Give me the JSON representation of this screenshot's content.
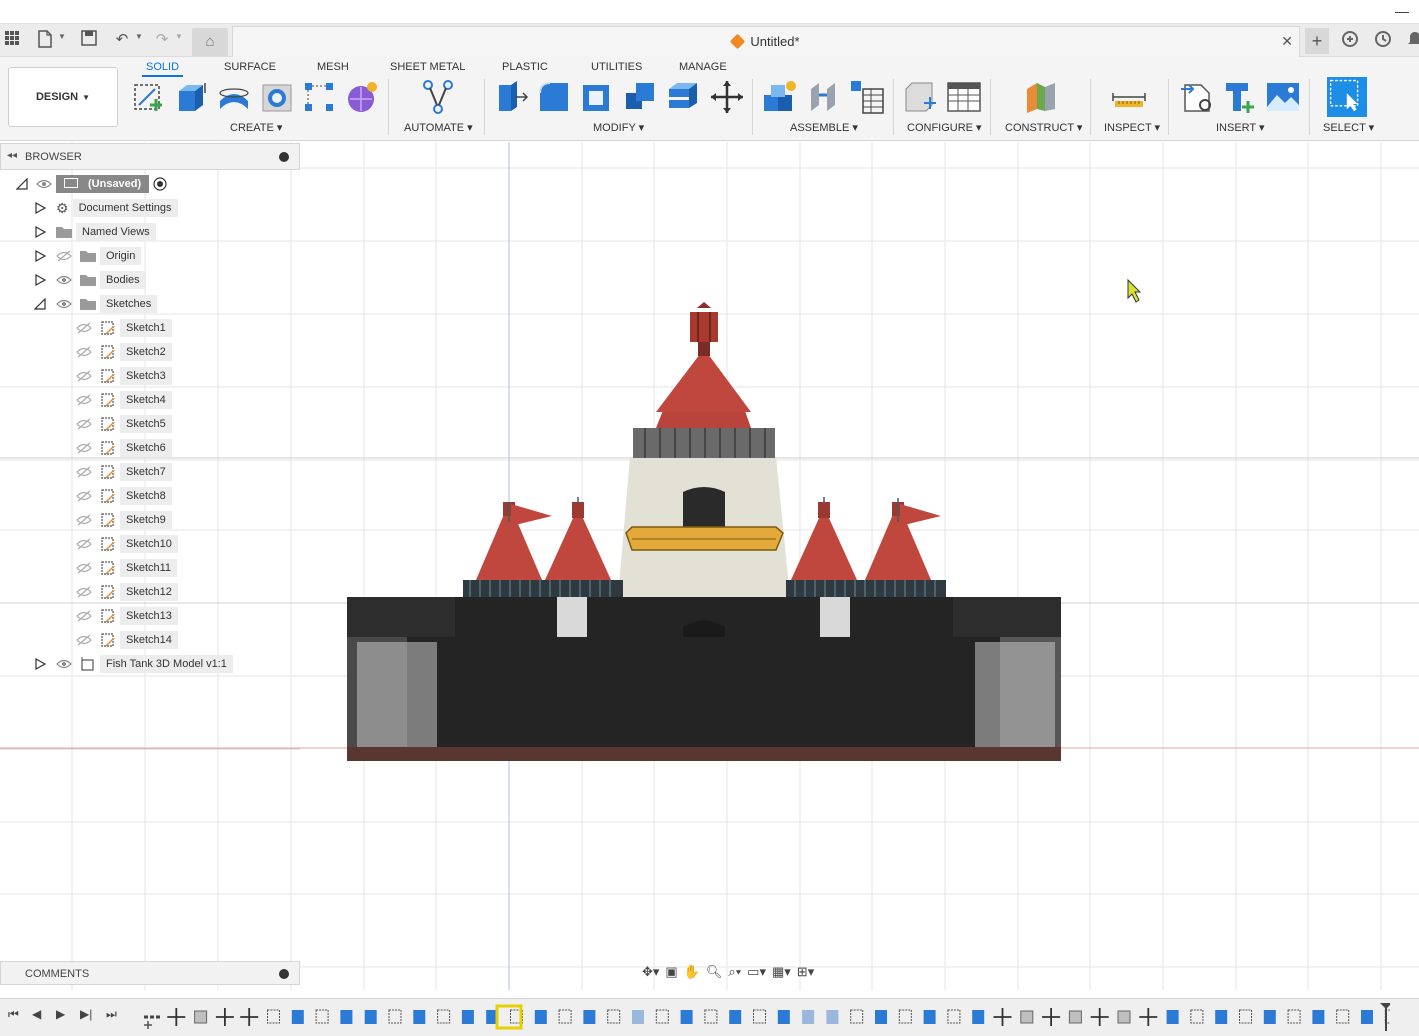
{
  "document": {
    "title": "Untitled*"
  },
  "workspace": {
    "label": "DESIGN"
  },
  "ribbon_tabs": [
    "SOLID",
    "SURFACE",
    "MESH",
    "SHEET METAL",
    "PLASTIC",
    "UTILITIES",
    "MANAGE"
  ],
  "active_tab": "SOLID",
  "tool_groups": [
    "CREATE",
    "AUTOMATE",
    "MODIFY",
    "ASSEMBLE",
    "CONFIGURE",
    "CONSTRUCT",
    "INSPECT",
    "INSERT",
    "SELECT"
  ],
  "browser": {
    "title": "BROWSER",
    "root": "(Unsaved)",
    "items": [
      "Document Settings",
      "Named Views",
      "Origin",
      "Bodies",
      "Sketches"
    ],
    "sketches": [
      "Sketch1",
      "Sketch2",
      "Sketch3",
      "Sketch4",
      "Sketch5",
      "Sketch6",
      "Sketch7",
      "Sketch8",
      "Sketch9",
      "Sketch10",
      "Sketch11",
      "Sketch12",
      "Sketch13",
      "Sketch14"
    ],
    "component": "Fish Tank 3D Model v1:1"
  },
  "comments": {
    "title": "COMMENTS"
  },
  "colors": {
    "accent": "#0a76d8",
    "roof_red": "#c0473d",
    "tank_dark": "#222222",
    "gold_band": "#e3a93a"
  },
  "icons": [
    "apps-grid-icon",
    "file-icon",
    "save-icon",
    "undo-icon",
    "redo-icon",
    "home-icon",
    "close-icon",
    "plus-icon",
    "extensions-icon",
    "job-status-icon",
    "notification-icon"
  ]
}
